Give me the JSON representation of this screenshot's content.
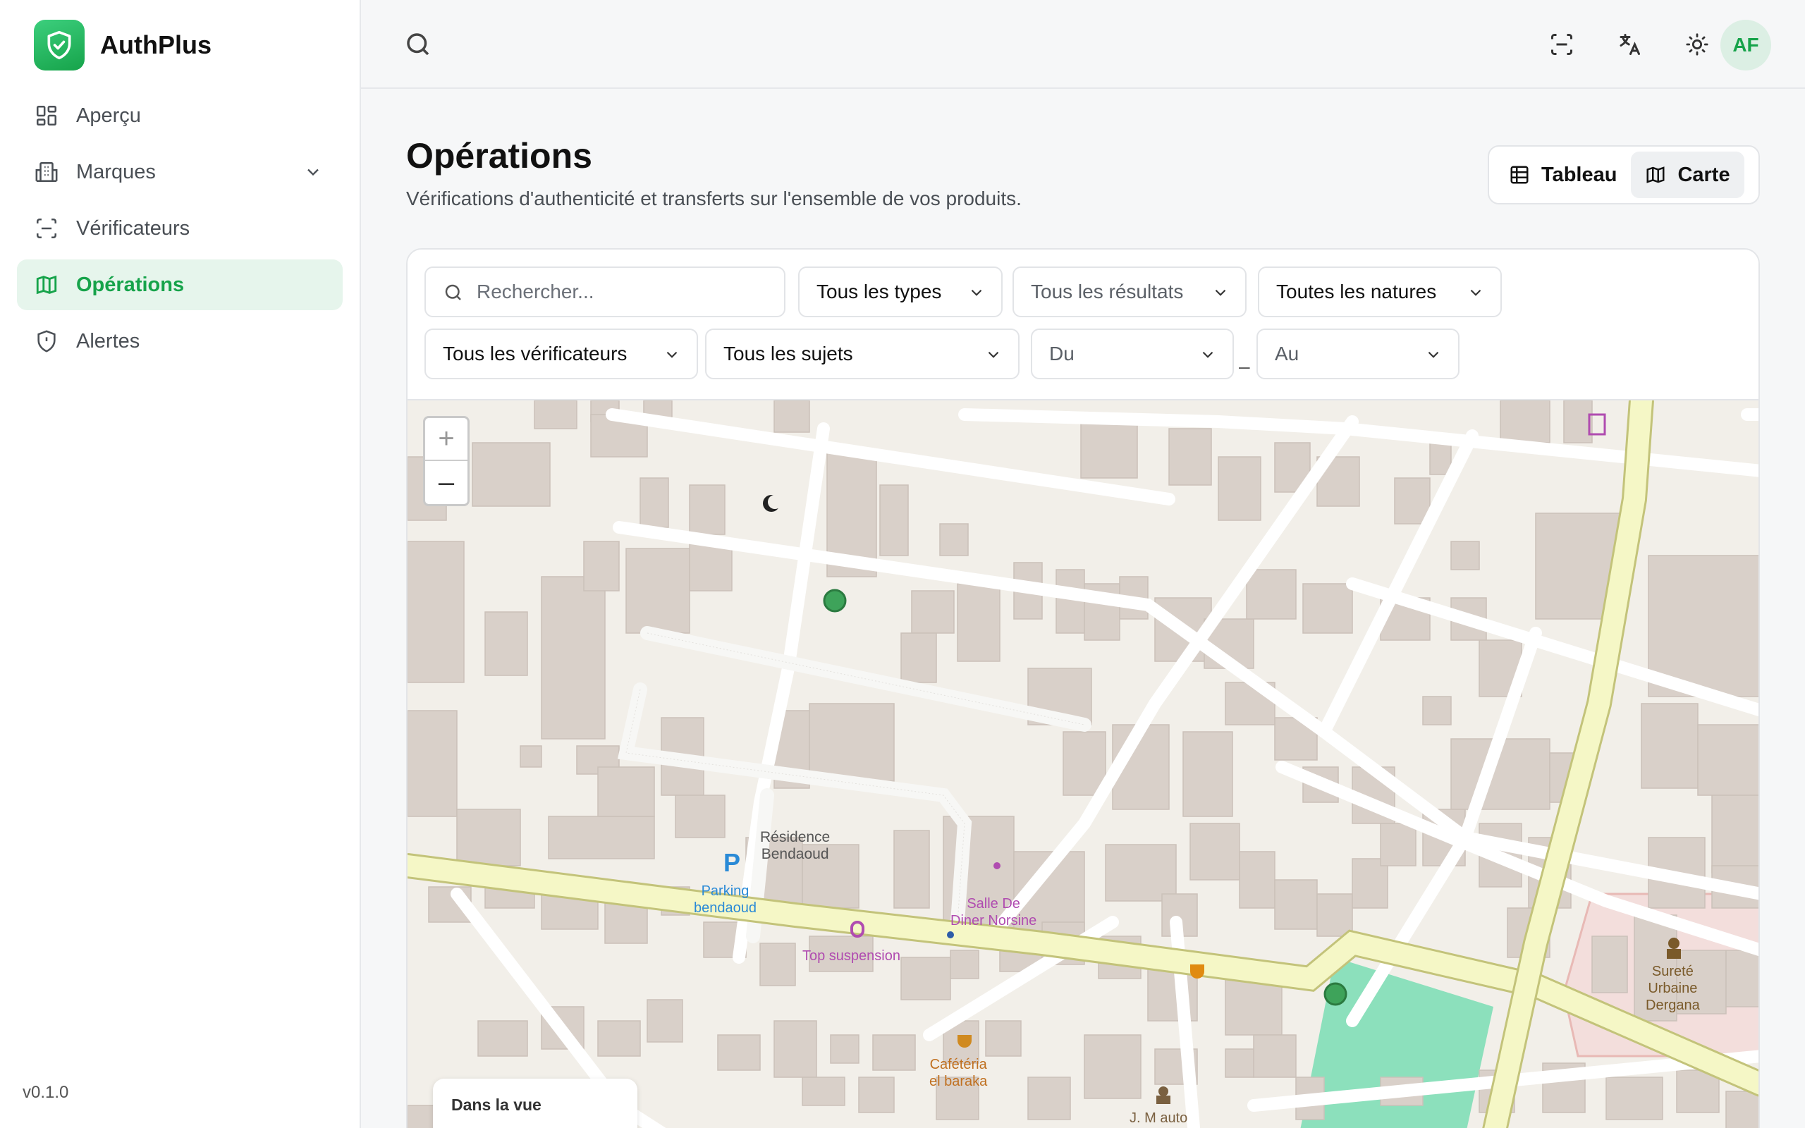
{
  "app": {
    "name": "AuthPlus",
    "version": "v0.1.0"
  },
  "sidebar": {
    "items": [
      {
        "label": "Aperçu",
        "icon": "grid-icon"
      },
      {
        "label": "Marques",
        "icon": "building-icon",
        "has_submenu": true
      },
      {
        "label": "Vérificateurs",
        "icon": "scan-icon"
      },
      {
        "label": "Opérations",
        "icon": "map-icon",
        "active": true
      },
      {
        "label": "Alertes",
        "icon": "shield-alert-icon"
      }
    ]
  },
  "topbar": {
    "avatar_initials": "AF",
    "icons": [
      "search-icon",
      "scan-icon",
      "translate-icon",
      "sun-icon"
    ]
  },
  "page": {
    "title": "Opérations",
    "subtitle": "Vérifications d'authenticité et transferts sur l'ensemble de vos produits."
  },
  "view_toggle": {
    "table_label": "Tableau",
    "map_label": "Carte",
    "selected": "Carte"
  },
  "filters": {
    "search_placeholder": "Rechercher...",
    "type": "Tous les types",
    "result": "Tous les résultats",
    "nature": "Toutes les natures",
    "verifier": "Tous les vérificateurs",
    "subject": "Tous les sujets",
    "from": "Du",
    "to": "Au",
    "range_separator": "–"
  },
  "map": {
    "zoom_in": "+",
    "zoom_out": "–",
    "labels": {
      "residence": "Résidence\nBendaoud",
      "parking": "Parking\nbendaoud",
      "parking_symbol": "P",
      "salle": "Salle De\nDiner Norsine",
      "top_suspension": "Top suspension",
      "cafeteria": "Cafétéria\nel baraka",
      "surete": "Sureté\nUrbaine\nDergana",
      "m_auto": "J. M auto"
    },
    "in_view_label": "Dans la vue",
    "colors": {
      "marker": "#3ea35a",
      "primary_road": "#f5f7c6",
      "park": "#8ce0bc",
      "building": "#d9d0c9"
    }
  }
}
